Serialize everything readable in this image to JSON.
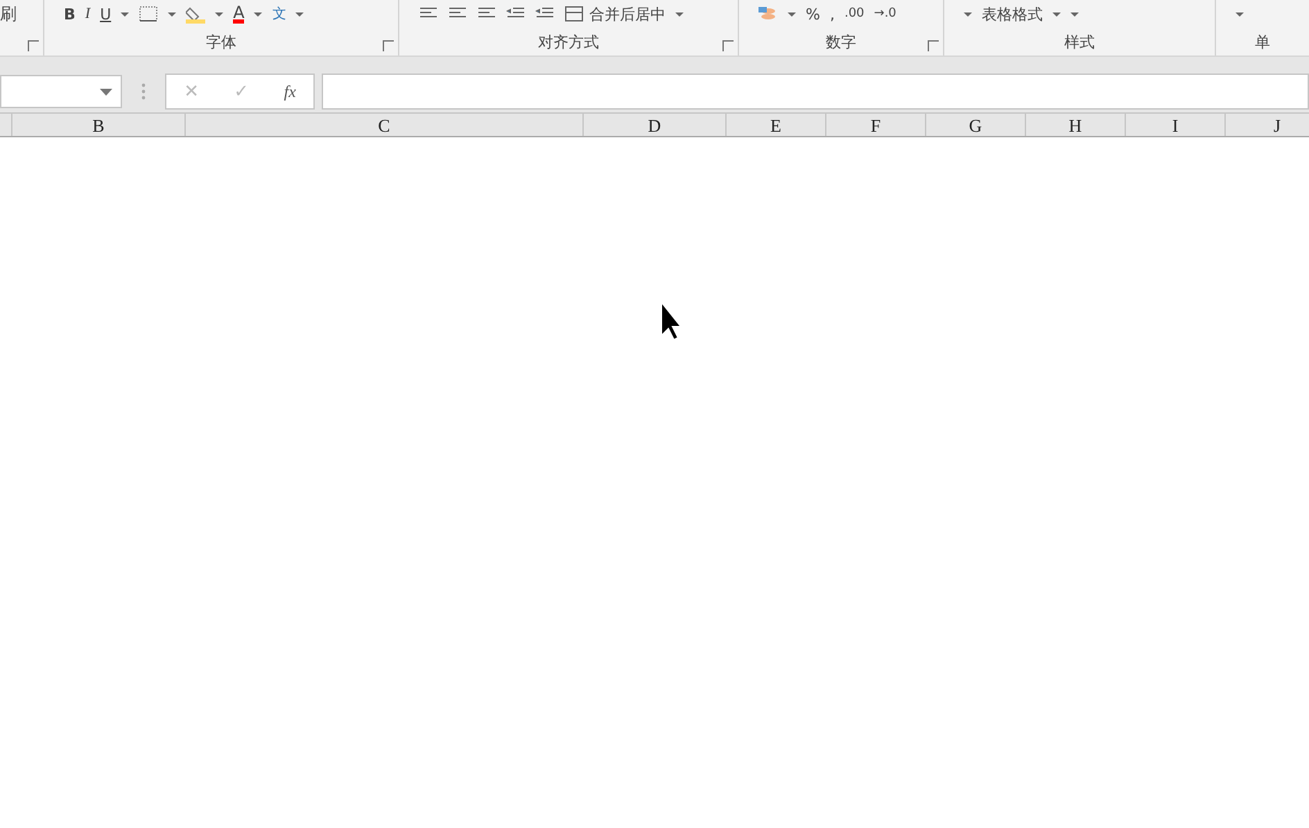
{
  "ribbon": {
    "groups": [
      {
        "kind": "clipboard",
        "launcher": true,
        "items": [
          {
            "kind": "text",
            "text": "刷"
          }
        ]
      },
      {
        "kind": "font",
        "label": "字体",
        "launcher": true,
        "items": [
          {
            "kind": "bold",
            "text": "B"
          },
          {
            "kind": "italic",
            "text": "I"
          },
          {
            "kind": "underline",
            "text": "U"
          },
          {
            "kind": "caret"
          },
          {
            "kind": "border"
          },
          {
            "kind": "caret"
          },
          {
            "kind": "fill"
          },
          {
            "kind": "caret"
          },
          {
            "kind": "fontcolor",
            "text": "A"
          },
          {
            "kind": "caret"
          },
          {
            "kind": "phonetic",
            "text": "文"
          },
          {
            "kind": "caret"
          }
        ]
      },
      {
        "kind": "align",
        "label": "对齐方式",
        "launcher": true,
        "items": [
          {
            "kind": "align"
          },
          {
            "kind": "align"
          },
          {
            "kind": "align"
          },
          {
            "kind": "indent"
          },
          {
            "kind": "indent"
          },
          {
            "kind": "merge",
            "text": "合并后居中"
          },
          {
            "kind": "caret"
          }
        ]
      },
      {
        "kind": "number",
        "label": "数字",
        "launcher": true,
        "items": [
          {
            "kind": "coins"
          },
          {
            "kind": "caret"
          },
          {
            "kind": "text",
            "text": "%"
          },
          {
            "kind": "text",
            "text": ","
          },
          {
            "kind": "small",
            "text": ".00"
          },
          {
            "kind": "small",
            "text": "→.0"
          }
        ]
      },
      {
        "kind": "styles",
        "label": "样式",
        "launcher": false,
        "items": [
          {
            "kind": "caret"
          },
          {
            "kind": "text",
            "text": "表格格式"
          },
          {
            "kind": "caret"
          },
          {
            "kind": "caret"
          }
        ]
      },
      {
        "kind": "cells",
        "label": "单",
        "launcher": false,
        "items": [
          {
            "kind": "caret"
          }
        ]
      }
    ]
  },
  "formula_bar": {
    "cancel": "✕",
    "enter": "✓",
    "function": "fx"
  },
  "columns": [
    {
      "label": "B"
    },
    {
      "label": "C"
    },
    {
      "label": "D"
    },
    {
      "label": "E"
    },
    {
      "label": "F"
    },
    {
      "label": "G"
    },
    {
      "label": "H"
    },
    {
      "label": "I"
    },
    {
      "label": "J"
    }
  ]
}
